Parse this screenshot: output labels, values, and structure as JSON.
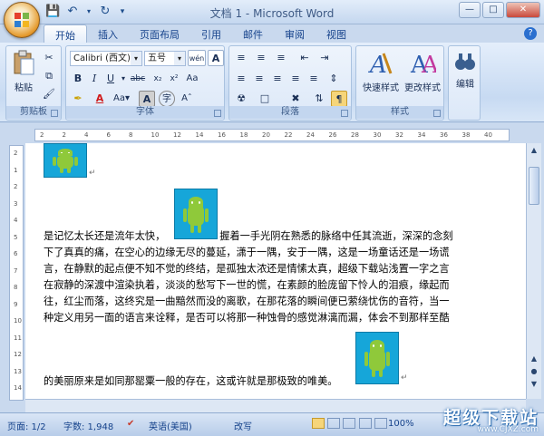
{
  "window": {
    "title": "文档 1 - Microsoft Word"
  },
  "qat": {
    "save_icon": "save-icon",
    "undo_icon": "undo-icon",
    "redo_icon": "redo-icon"
  },
  "tabs": [
    {
      "label": "开始",
      "active": true
    },
    {
      "label": "插入"
    },
    {
      "label": "页面布局"
    },
    {
      "label": "引用"
    },
    {
      "label": "邮件"
    },
    {
      "label": "审阅"
    },
    {
      "label": "视图"
    }
  ],
  "ribbon": {
    "clipboard": {
      "label": "剪贴板",
      "paste": "粘贴"
    },
    "font": {
      "label": "字体",
      "font_name": "Calibri (西文)",
      "font_size": "五号",
      "wen": "wén"
    },
    "paragraph": {
      "label": "段落"
    },
    "styles": {
      "label": "样式",
      "quick_styles": "快速样式",
      "change_styles": "更改样式"
    },
    "editing": {
      "label": "编辑",
      "editing": "编辑"
    }
  },
  "ruler": {
    "corner": "L",
    "h_ticks": [
      "2",
      "2",
      "4",
      "6",
      "8",
      "10",
      "12",
      "14",
      "16",
      "18",
      "20",
      "22",
      "24",
      "26",
      "28",
      "30",
      "32",
      "34",
      "36",
      "38",
      "40"
    ],
    "v_ticks": [
      "2",
      "1",
      "2",
      "3",
      "4",
      "5",
      "6",
      "7",
      "8",
      "9",
      "10",
      "11",
      "12",
      "13",
      "14"
    ]
  },
  "document": {
    "line1": "是记忆太长还是流年太快，",
    "line1_tail": "握着一手光阴在熟悉的脉络中任其流逝，深深的念刻",
    "lines": [
      "下了真真的痛，在空心的边缘无尽的蔓延，潇于一隅，安于一隅，这是一场童话还是一场谎",
      "言，在静默的起点便不知不觉的终结，是孤独太浓还是情愫太真，超级下载站浅置一字之言",
      "在寂静的深渡中渲染执着，淡淡的愁写下一世的慌，在素颜的脸庞留下怜人的泪痕，缘起而",
      "往，红尘而落，这终究是一曲黯然而没的离歌，在那花落的瞬间便已萦绕忧伤的音符，当一",
      "种定义用另一面的语言来诠释，是否可以将那一种蚀骨的感觉淋漓而漏，体会不到那样至酷"
    ],
    "last_line": "的美丽原来是如同那罂粟一般的存在，这或许就是那极致的唯美。",
    "para_mark": "↵"
  },
  "statusbar": {
    "page": "页面: 1/2",
    "words": "字数: 1,948",
    "language": "英语(美国)",
    "mode": "改写",
    "zoom": "100%"
  },
  "watermark": {
    "big": "超级下载站",
    "small": "www.CJXZ.com"
  },
  "colors": {
    "ribbon_bg": "#c7daf2",
    "accent": "#15428b",
    "robot_bg": "#16a6d9",
    "robot_green": "#8fc93a"
  }
}
